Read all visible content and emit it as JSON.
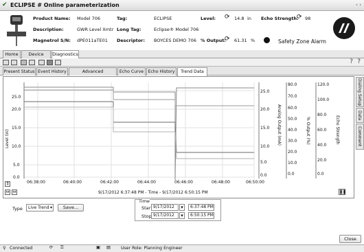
{
  "window": {
    "title": "ECLIPSE # Online parameterization"
  },
  "device": {
    "rows": [
      {
        "l1": "Product Name:",
        "v1": "Model 706",
        "l2": "Tag:",
        "v2": "ECLIPSE",
        "l3": "Level:",
        "v3": "14.8",
        "u3": "in",
        "l4": "Echo Strength:",
        "v4": "98"
      },
      {
        "l1": "Description:",
        "v1": "GWR Level Xmtr",
        "l2": "Long Tag:",
        "v2": "Eclipse® Model 706"
      },
      {
        "l1": "Magnetrol S/N:",
        "v1": "dPE011aTE01",
        "l2": "Descriptor:",
        "v2": "BOYCES DEMO 706",
        "l3": "% Output:",
        "v3": "61.31",
        "u3": "%",
        "l4": "Safety Zone Alarm"
      }
    ]
  },
  "main_tabs": [
    "Home",
    "Device Setup",
    "Diagnostics"
  ],
  "sub_tabs": [
    "Present Status",
    "Event History",
    "Advanced Diagnostics",
    "Echo Curve",
    "Echo History",
    "Trend Data"
  ],
  "side_tabs": [
    "Dialing Setup",
    "Data",
    "Comment"
  ],
  "plot": {
    "range_text": "9/17/2012 6:37:48 PM - Time - 9/17/2012 6:50:15 PM",
    "x_ticks": [
      "06:38:00",
      "06:40:00",
      "06:42:00",
      "06:44:00",
      "06:46:00",
      "06:48:00",
      "06:50:00"
    ],
    "y_axes": [
      {
        "label": "Level (in)",
        "ticks": [
          "25.0",
          "20.0",
          "15.0",
          "10.0",
          "5.0",
          "0.0"
        ]
      },
      {
        "label": "Analog Output (mA)",
        "ticks": [
          "25.0",
          "20.0",
          "15.0",
          "10.0",
          "5.0",
          "0.0"
        ]
      },
      {
        "label": "% Output (%)",
        "ticks": [
          "80.0",
          "70.0",
          "60.0",
          "50.0",
          "40.0",
          "30.0",
          "20.0",
          "10.0",
          "0.0"
        ]
      },
      {
        "label": "Echo Strength",
        "ticks": [
          "120.0",
          "100.0",
          "80.0",
          "60.0",
          "40.0",
          "20.0",
          "0.0"
        ]
      }
    ]
  },
  "controls": {
    "type_label": "Type",
    "type_value": "Live Trend",
    "save_label": "Save...",
    "time_label": "Time",
    "start_label": "Start",
    "start_date": "9/17/2012",
    "start_time": "6:37:48 PM",
    "stop_label": "Stop",
    "stop_date": "9/17/2012",
    "stop_time": "6:50:15 PM"
  },
  "footer": {
    "close_label": "Close",
    "status_connected": "Connected",
    "status_user": "User Role: Planning Engineer"
  },
  "colors": {
    "accent": "#4a4a4a",
    "selected_tab": "#ffffff"
  }
}
